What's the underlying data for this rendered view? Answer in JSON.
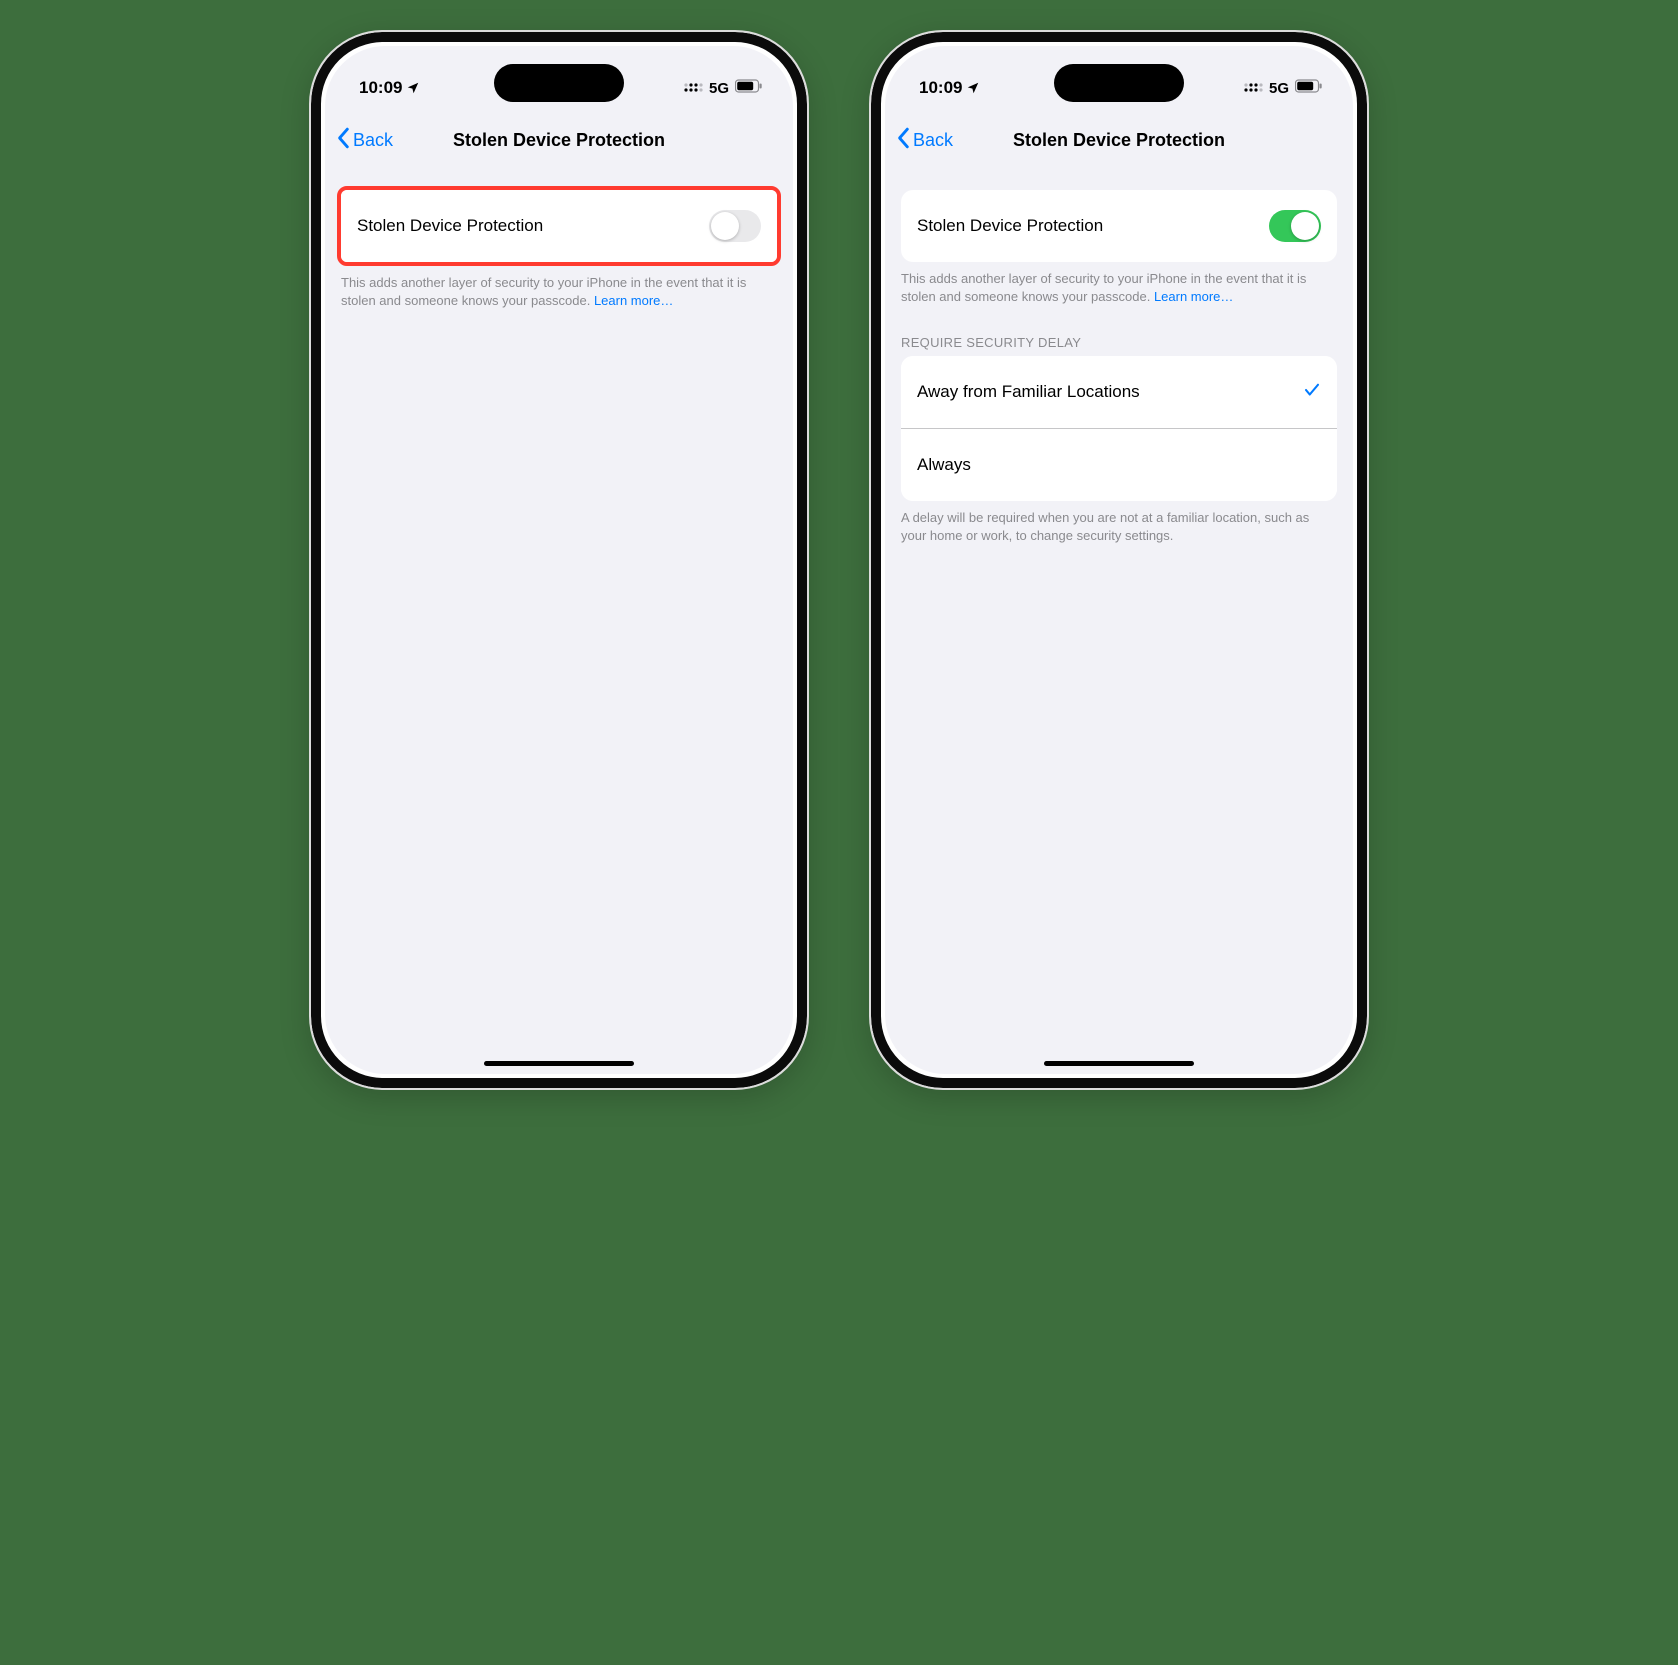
{
  "statusbar": {
    "time": "10:09",
    "network_label": "5G"
  },
  "nav": {
    "back_label": "Back",
    "title": "Stolen Device Protection"
  },
  "toggle_row": {
    "label": "Stolen Device Protection"
  },
  "footer": {
    "text": "This adds another layer of security to your iPhone in the event that it is stolen and someone knows your passcode. ",
    "learn_more": "Learn more…"
  },
  "delay_section": {
    "header": "REQUIRE SECURITY DELAY",
    "options": [
      {
        "label": "Away from Familiar Locations",
        "checked": true
      },
      {
        "label": "Always",
        "checked": false
      }
    ],
    "footer": "A delay will be required when you are not at a familiar location, such as your home or work, to change security settings."
  }
}
